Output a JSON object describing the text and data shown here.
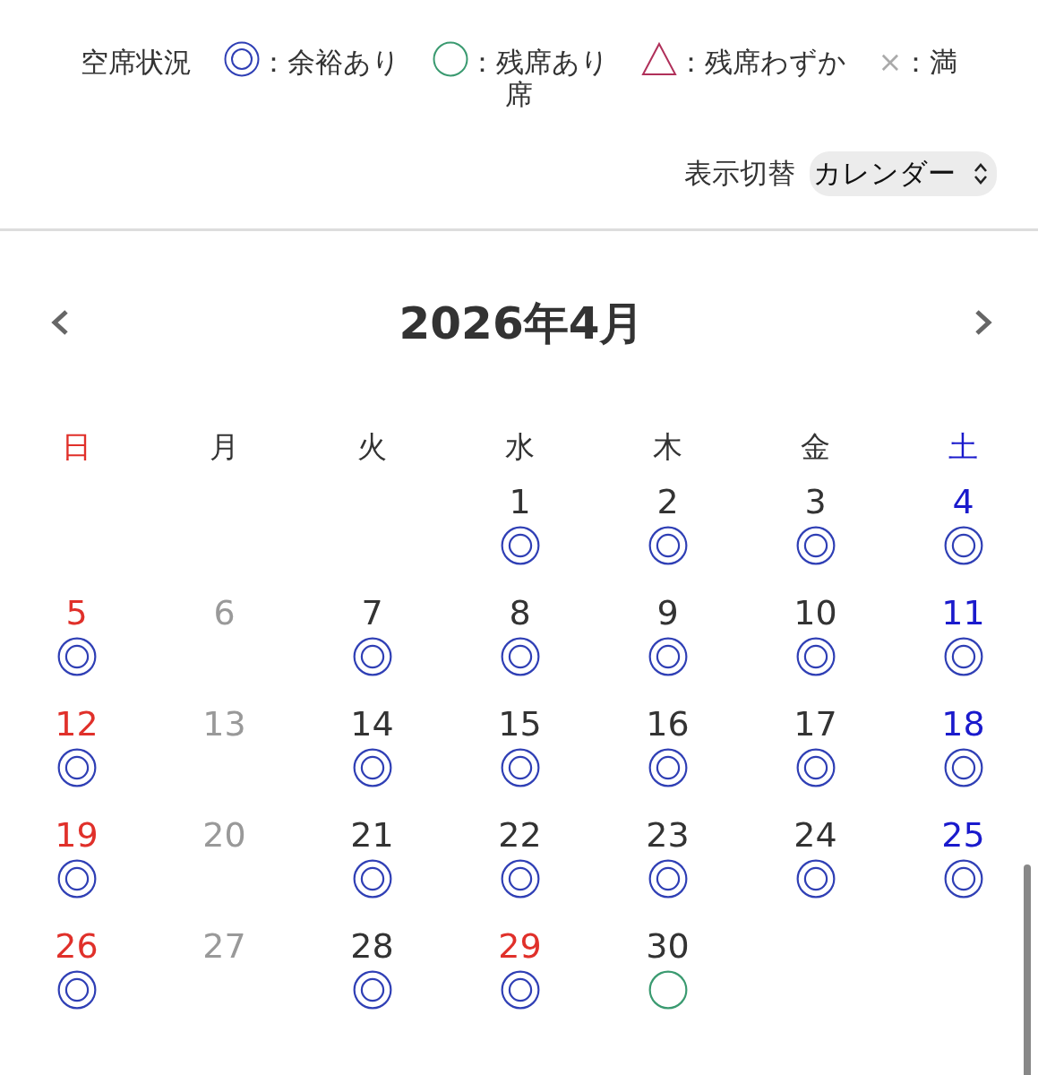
{
  "legend": {
    "title": "空席状況",
    "items": [
      {
        "kind": "plenty",
        "label": "：余裕あり"
      },
      {
        "kind": "available",
        "label": "：残席あり"
      },
      {
        "kind": "few",
        "label": "：残席わずか"
      },
      {
        "kind": "full",
        "symbol": "×",
        "label": "：満"
      }
    ],
    "wrapped_text": "席"
  },
  "view_switch": {
    "label": "表示切替",
    "value": "カレンダー"
  },
  "calendar": {
    "title": "2026年4月",
    "weekdays": [
      {
        "label": "日",
        "color": "#e0302a"
      },
      {
        "label": "月",
        "color": "#333333"
      },
      {
        "label": "火",
        "color": "#333333"
      },
      {
        "label": "水",
        "color": "#333333"
      },
      {
        "label": "木",
        "color": "#333333"
      },
      {
        "label": "金",
        "color": "#333333"
      },
      {
        "label": "土",
        "color": "#1a1acc"
      }
    ],
    "weeks": [
      [
        {
          "kind": "blank"
        },
        {
          "kind": "blank"
        },
        {
          "kind": "blank"
        },
        {
          "kind": "plenty",
          "date": "1",
          "color": "#333333"
        },
        {
          "kind": "plenty",
          "date": "2",
          "color": "#333333"
        },
        {
          "kind": "plenty",
          "date": "3",
          "color": "#333333"
        },
        {
          "kind": "plenty",
          "date": "4",
          "color": "#1a1acc"
        }
      ],
      [
        {
          "kind": "plenty",
          "date": "5",
          "color": "#e0302a"
        },
        {
          "kind": "closed",
          "date": "6",
          "color": "#999999"
        },
        {
          "kind": "plenty",
          "date": "7",
          "color": "#333333"
        },
        {
          "kind": "plenty",
          "date": "8",
          "color": "#333333"
        },
        {
          "kind": "plenty",
          "date": "9",
          "color": "#333333"
        },
        {
          "kind": "plenty",
          "date": "10",
          "color": "#333333"
        },
        {
          "kind": "plenty",
          "date": "11",
          "color": "#1a1acc"
        }
      ],
      [
        {
          "kind": "plenty",
          "date": "12",
          "color": "#e0302a"
        },
        {
          "kind": "closed",
          "date": "13",
          "color": "#999999"
        },
        {
          "kind": "plenty",
          "date": "14",
          "color": "#333333"
        },
        {
          "kind": "plenty",
          "date": "15",
          "color": "#333333"
        },
        {
          "kind": "plenty",
          "date": "16",
          "color": "#333333"
        },
        {
          "kind": "plenty",
          "date": "17",
          "color": "#333333"
        },
        {
          "kind": "plenty",
          "date": "18",
          "color": "#1a1acc"
        }
      ],
      [
        {
          "kind": "plenty",
          "date": "19",
          "color": "#e0302a"
        },
        {
          "kind": "closed",
          "date": "20",
          "color": "#999999"
        },
        {
          "kind": "plenty",
          "date": "21",
          "color": "#333333"
        },
        {
          "kind": "plenty",
          "date": "22",
          "color": "#333333"
        },
        {
          "kind": "plenty",
          "date": "23",
          "color": "#333333"
        },
        {
          "kind": "plenty",
          "date": "24",
          "color": "#333333"
        },
        {
          "kind": "plenty",
          "date": "25",
          "color": "#1a1acc"
        }
      ],
      [
        {
          "kind": "plenty",
          "date": "26",
          "color": "#e0302a"
        },
        {
          "kind": "closed",
          "date": "27",
          "color": "#999999"
        },
        {
          "kind": "plenty",
          "date": "28",
          "color": "#333333"
        },
        {
          "kind": "plenty",
          "date": "29",
          "color": "#e0302a"
        },
        {
          "kind": "available",
          "date": "30",
          "color": "#333333"
        },
        {
          "kind": "blank"
        },
        {
          "kind": "blank"
        }
      ]
    ]
  }
}
